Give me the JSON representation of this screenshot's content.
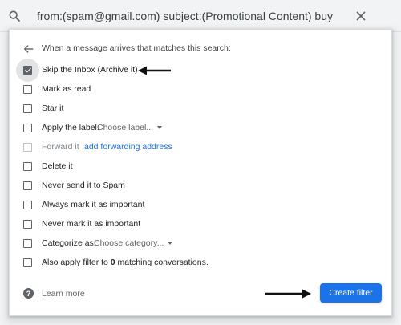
{
  "search": {
    "query": "from:(spam@gmail.com) subject:(Promotional Content) buy"
  },
  "filter_panel": {
    "header": "When a message arrives that matches this search:",
    "options": [
      {
        "label": "Skip the Inbox (Archive it)",
        "checked": true,
        "enabled": true
      },
      {
        "label": "Mark as read",
        "checked": false,
        "enabled": true
      },
      {
        "label": "Star it",
        "checked": false,
        "enabled": true
      },
      {
        "label": "Apply the label:",
        "checked": false,
        "enabled": true,
        "select_value": "Choose label..."
      },
      {
        "label": "Forward it",
        "checked": false,
        "enabled": false,
        "link": "add forwarding address"
      },
      {
        "label": "Delete it",
        "checked": false,
        "enabled": true
      },
      {
        "label": "Never send it to Spam",
        "checked": false,
        "enabled": true
      },
      {
        "label": "Always mark it as important",
        "checked": false,
        "enabled": true
      },
      {
        "label": "Never mark it as important",
        "checked": false,
        "enabled": true
      },
      {
        "label": "Categorize as:",
        "checked": false,
        "enabled": true,
        "select_value": "Choose category..."
      },
      {
        "label_prefix": "Also apply filter to ",
        "count": "0",
        "label_suffix": " matching conversations.",
        "checked": false,
        "enabled": true
      }
    ],
    "learn_more": "Learn more",
    "create_button": "Create filter"
  },
  "icons": {
    "search": "search-icon",
    "close": "close-icon",
    "back": "back-arrow-icon",
    "help": "help-icon",
    "annotation_left": "annotation-arrow-left-icon",
    "annotation_right": "annotation-arrow-right-icon"
  },
  "colors": {
    "accent": "#1a73e8",
    "checked": "#5f6368",
    "background": "#f1f3f4"
  }
}
